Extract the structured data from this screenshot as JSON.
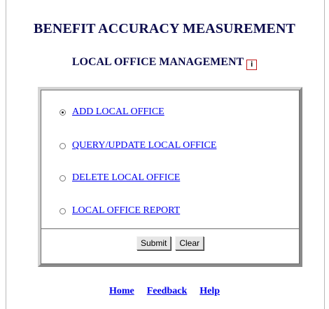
{
  "page": {
    "app_title": "BENEFIT ACCURACY MEASUREMENT",
    "subtitle": "LOCAL OFFICE MANAGEMENT",
    "info_icon_glyph": "i"
  },
  "options": [
    {
      "label": "ADD LOCAL OFFICE",
      "selected": true
    },
    {
      "label": "QUERY/UPDATE LOCAL OFFICE",
      "selected": false
    },
    {
      "label": "DELETE LOCAL OFFICE",
      "selected": false
    },
    {
      "label": "LOCAL OFFICE REPORT",
      "selected": false
    }
  ],
  "buttons": {
    "submit": "Submit",
    "clear": "Clear"
  },
  "footer": {
    "home": "Home",
    "feedback": "Feedback",
    "help": "Help"
  },
  "colors": {
    "title": "#0d0d4d",
    "link": "#0000ee",
    "info_icon_border": "#c01818"
  }
}
